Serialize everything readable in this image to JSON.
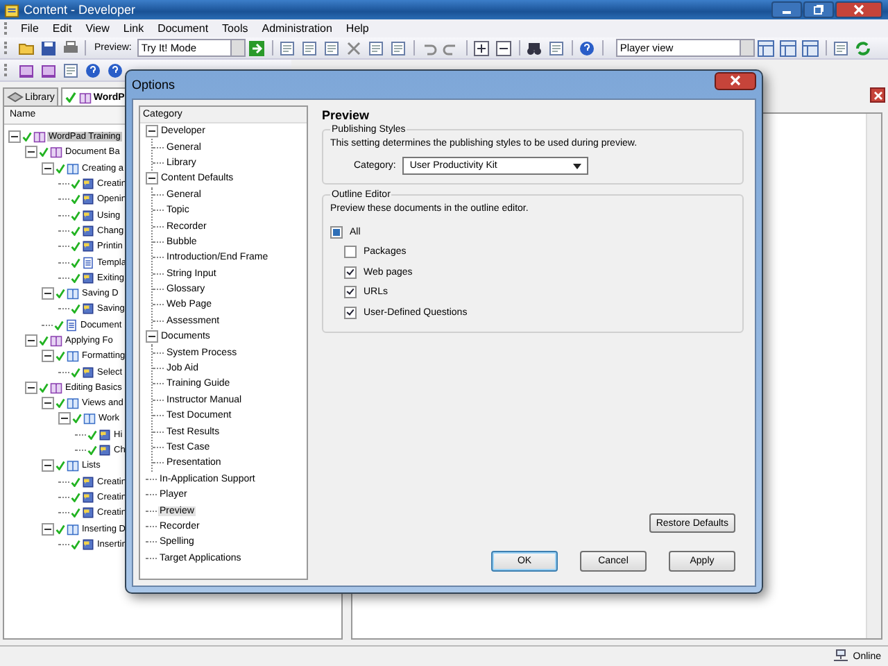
{
  "window": {
    "title": "Content - Developer"
  },
  "menu": [
    "File",
    "Edit",
    "View",
    "Link",
    "Document",
    "Tools",
    "Administration",
    "Help"
  ],
  "toolbar": {
    "preview_label": "Preview:",
    "preview_mode": "Try It! Mode",
    "view_mode": "Player view"
  },
  "tabs": [
    {
      "label": "Library",
      "selected": false
    },
    {
      "label": "WordP",
      "selected": true
    }
  ],
  "outline": {
    "column": "Name",
    "items": [
      {
        "label": "WordPad Training",
        "kind": "module",
        "checked": true,
        "selected": true,
        "expanded": true,
        "children": [
          {
            "label": "Document Ba",
            "kind": "module",
            "checked": true,
            "selected": false,
            "expanded": true,
            "children": [
              {
                "label": "Creating a",
                "kind": "section",
                "checked": true,
                "selected": false,
                "expanded": true,
                "children": [
                  {
                    "label": "Creatin",
                    "kind": "topic",
                    "checked": true,
                    "selected": false
                  },
                  {
                    "label": "Openin",
                    "kind": "topic",
                    "checked": true,
                    "selected": false
                  },
                  {
                    "label": "Using",
                    "kind": "topic",
                    "checked": true,
                    "selected": false
                  },
                  {
                    "label": "Chang",
                    "kind": "topic",
                    "checked": true,
                    "selected": false
                  },
                  {
                    "label": "Printin",
                    "kind": "topic",
                    "checked": true,
                    "selected": false
                  },
                  {
                    "label": "Templa",
                    "kind": "document",
                    "checked": true,
                    "selected": false
                  },
                  {
                    "label": "Exiting",
                    "kind": "topic",
                    "checked": true,
                    "selected": false
                  }
                ]
              },
              {
                "label": "Saving D",
                "kind": "section",
                "checked": true,
                "selected": false,
                "expanded": true,
                "children": [
                  {
                    "label": "Saving",
                    "kind": "topic",
                    "checked": true,
                    "selected": false
                  }
                ]
              },
              {
                "label": "Document",
                "kind": "document",
                "checked": true,
                "selected": false
              }
            ]
          },
          {
            "label": "Applying Fo",
            "kind": "module",
            "checked": true,
            "selected": false,
            "expanded": true,
            "children": [
              {
                "label": "Formatting",
                "kind": "section",
                "checked": true,
                "selected": false,
                "expanded": true,
                "children": [
                  {
                    "label": "Select",
                    "kind": "topic",
                    "checked": true,
                    "selected": false
                  }
                ]
              }
            ]
          },
          {
            "label": "Editing Basics",
            "kind": "module",
            "checked": true,
            "selected": false,
            "expanded": true,
            "children": [
              {
                "label": "Views and",
                "kind": "section",
                "checked": true,
                "selected": false,
                "expanded": true,
                "children": [
                  {
                    "label": "Work",
                    "kind": "section",
                    "checked": true,
                    "selected": false,
                    "expanded": true,
                    "children": [
                      {
                        "label": "Hi",
                        "kind": "topic",
                        "checked": true,
                        "selected": false
                      },
                      {
                        "label": "Ch",
                        "kind": "topic",
                        "checked": true,
                        "selected": false
                      }
                    ]
                  }
                ]
              },
              {
                "label": "Lists",
                "kind": "section",
                "checked": true,
                "selected": false,
                "expanded": true,
                "children": [
                  {
                    "label": "Creatin",
                    "kind": "topic",
                    "checked": true,
                    "selected": false
                  },
                  {
                    "label": "Creatin",
                    "kind": "topic",
                    "checked": true,
                    "selected": false
                  },
                  {
                    "label": "Creatin",
                    "kind": "topic",
                    "checked": true,
                    "selected": false
                  }
                ]
              },
              {
                "label": "Inserting D",
                "kind": "section",
                "checked": true,
                "selected": false,
                "expanded": true,
                "children": [
                  {
                    "label": "Insertin",
                    "kind": "topic",
                    "checked": true,
                    "selected": false
                  }
                ]
              }
            ]
          }
        ]
      }
    ]
  },
  "options_dialog": {
    "title": "Options",
    "category_heading": "Category",
    "categories": [
      {
        "label": "Developer",
        "selected": false,
        "expanded": true,
        "children": [
          {
            "label": "General",
            "selected": false
          },
          {
            "label": "Library",
            "selected": false
          }
        ]
      },
      {
        "label": "Content Defaults",
        "selected": false,
        "expanded": true,
        "children": [
          {
            "label": "General",
            "selected": false
          },
          {
            "label": "Topic",
            "selected": false
          },
          {
            "label": "Recorder",
            "selected": false
          },
          {
            "label": "Bubble",
            "selected": false
          },
          {
            "label": "Introduction/End Frame",
            "selected": false
          },
          {
            "label": "String Input",
            "selected": false
          },
          {
            "label": "Glossary",
            "selected": false
          },
          {
            "label": "Web Page",
            "selected": false
          },
          {
            "label": "Assessment",
            "selected": false
          }
        ]
      },
      {
        "label": "Documents",
        "selected": false,
        "expanded": true,
        "children": [
          {
            "label": "System Process",
            "selected": false
          },
          {
            "label": "Job Aid",
            "selected": false
          },
          {
            "label": "Training Guide",
            "selected": false
          },
          {
            "label": "Instructor Manual",
            "selected": false
          },
          {
            "label": "Test Document",
            "selected": false
          },
          {
            "label": "Test Results",
            "selected": false
          },
          {
            "label": "Test Case",
            "selected": false
          },
          {
            "label": "Presentation",
            "selected": false
          }
        ]
      },
      {
        "label": "In-Application Support",
        "selected": false
      },
      {
        "label": "Player",
        "selected": false
      },
      {
        "label": "Preview",
        "selected": true
      },
      {
        "label": "Recorder",
        "selected": false
      },
      {
        "label": "Spelling",
        "selected": false
      },
      {
        "label": "Target Applications",
        "selected": false
      }
    ],
    "page_title": "Preview",
    "publishing_styles": {
      "title": "Publishing Styles",
      "description": "This setting determines the publishing styles to be used during preview.",
      "category_label": "Category:",
      "category_value": "User Productivity Kit"
    },
    "outline_editor": {
      "title": "Outline Editor",
      "description": "Preview these documents in the outline editor.",
      "all": {
        "label": "All",
        "indeterminate": true
      },
      "options": [
        {
          "label": "Packages",
          "checked": false
        },
        {
          "label": "Web pages",
          "checked": true
        },
        {
          "label": "URLs",
          "checked": true
        },
        {
          "label": "User-Defined Questions",
          "checked": true
        }
      ]
    },
    "restore_button": "Restore Defaults",
    "buttons": [
      {
        "label": "OK",
        "default": true
      },
      {
        "label": "Cancel",
        "default": false
      },
      {
        "label": "Apply",
        "default": false
      }
    ]
  },
  "status_bar": {
    "status": "Online"
  }
}
